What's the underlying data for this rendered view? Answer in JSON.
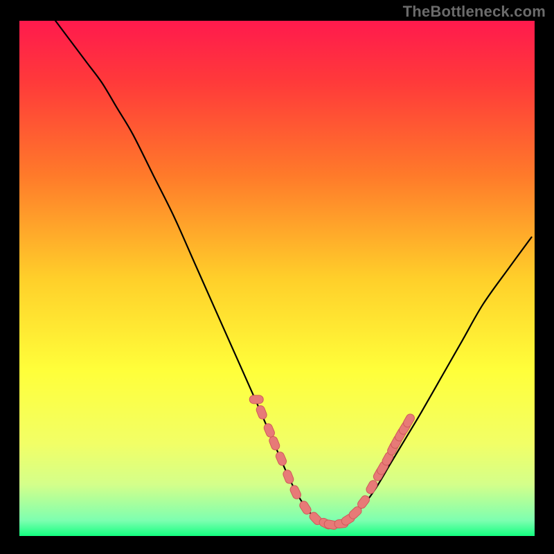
{
  "watermark": "TheBottleneck.com",
  "colors": {
    "frame_bg": "#000000",
    "curve": "#000000",
    "marker_fill": "#e77a77",
    "marker_stroke": "#cf5a5a",
    "gradient_stops": [
      {
        "offset": 0.0,
        "color": "#ff1a4d"
      },
      {
        "offset": 0.12,
        "color": "#ff3a3a"
      },
      {
        "offset": 0.3,
        "color": "#ff7a2a"
      },
      {
        "offset": 0.5,
        "color": "#ffcf2a"
      },
      {
        "offset": 0.68,
        "color": "#ffff3a"
      },
      {
        "offset": 0.82,
        "color": "#f2ff66"
      },
      {
        "offset": 0.9,
        "color": "#d4ff8a"
      },
      {
        "offset": 0.97,
        "color": "#7dffb0"
      },
      {
        "offset": 1.0,
        "color": "#14ff80"
      }
    ]
  },
  "chart_data": {
    "type": "line",
    "title": "",
    "xlabel": "",
    "ylabel": "",
    "xlim": [
      0,
      100
    ],
    "ylim": [
      0,
      100
    ],
    "series": [
      {
        "name": "curve",
        "x": [
          7,
          10,
          13,
          16,
          19,
          22,
          26,
          30,
          34,
          38,
          42,
          46,
          49,
          52,
          54,
          56,
          58,
          60,
          62,
          64,
          66,
          69,
          72,
          75,
          78,
          82,
          86,
          90,
          95,
          99.4
        ],
        "y": [
          100,
          96,
          92,
          88,
          83,
          78,
          70,
          62,
          53,
          44,
          35,
          26,
          19,
          12,
          8,
          5,
          3,
          2.2,
          2.2,
          3.2,
          5,
          9,
          14,
          19,
          24,
          31,
          38,
          45,
          52,
          58
        ]
      }
    ],
    "markers": {
      "name": "highlight-band",
      "points": [
        {
          "x": 46.0,
          "y": 26.5
        },
        {
          "x": 47.0,
          "y": 24.0
        },
        {
          "x": 48.5,
          "y": 20.5
        },
        {
          "x": 49.5,
          "y": 18.0
        },
        {
          "x": 50.8,
          "y": 15.0
        },
        {
          "x": 52.2,
          "y": 11.5
        },
        {
          "x": 53.6,
          "y": 8.5
        },
        {
          "x": 55.5,
          "y": 5.5
        },
        {
          "x": 57.5,
          "y": 3.4
        },
        {
          "x": 59.5,
          "y": 2.4
        },
        {
          "x": 60.5,
          "y": 2.2
        },
        {
          "x": 62.5,
          "y": 2.4
        },
        {
          "x": 63.8,
          "y": 3.2
        },
        {
          "x": 65.2,
          "y": 4.5
        },
        {
          "x": 66.8,
          "y": 6.6
        },
        {
          "x": 68.4,
          "y": 9.5
        },
        {
          "x": 69.8,
          "y": 12.0
        },
        {
          "x": 70.5,
          "y": 13.2
        },
        {
          "x": 71.5,
          "y": 15.0
        },
        {
          "x": 72.5,
          "y": 17.0
        },
        {
          "x": 73.2,
          "y": 18.3
        },
        {
          "x": 74.0,
          "y": 19.7
        },
        {
          "x": 74.8,
          "y": 21.0
        },
        {
          "x": 75.6,
          "y": 22.4
        }
      ]
    }
  }
}
